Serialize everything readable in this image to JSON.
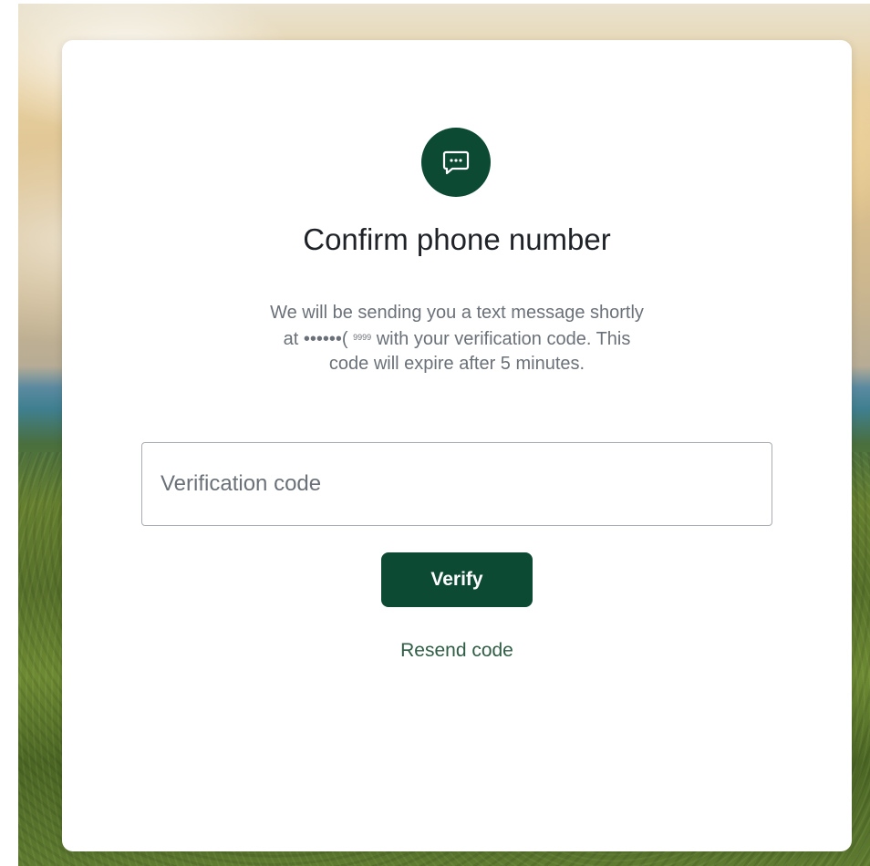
{
  "dialog": {
    "icon": "chat-message-icon",
    "title": "Confirm phone number",
    "description": {
      "line1": "We will be sending you a text message shortly",
      "line2_prefix": "at ",
      "masked_phone_dots": "••••••(",
      "masked_phone_tail": "9999",
      "line2_suffix": " with your verification code. This",
      "line3": "code will expire after 5 minutes."
    },
    "code_input": {
      "value": "",
      "placeholder": "Verification code"
    },
    "verify_button_label": "Verify",
    "resend_link_label": "Resend code"
  },
  "colors": {
    "brand_green": "#0c4a34",
    "link_green": "#2f5d45",
    "text_dark": "#1f2328",
    "text_muted": "#6b7178"
  }
}
